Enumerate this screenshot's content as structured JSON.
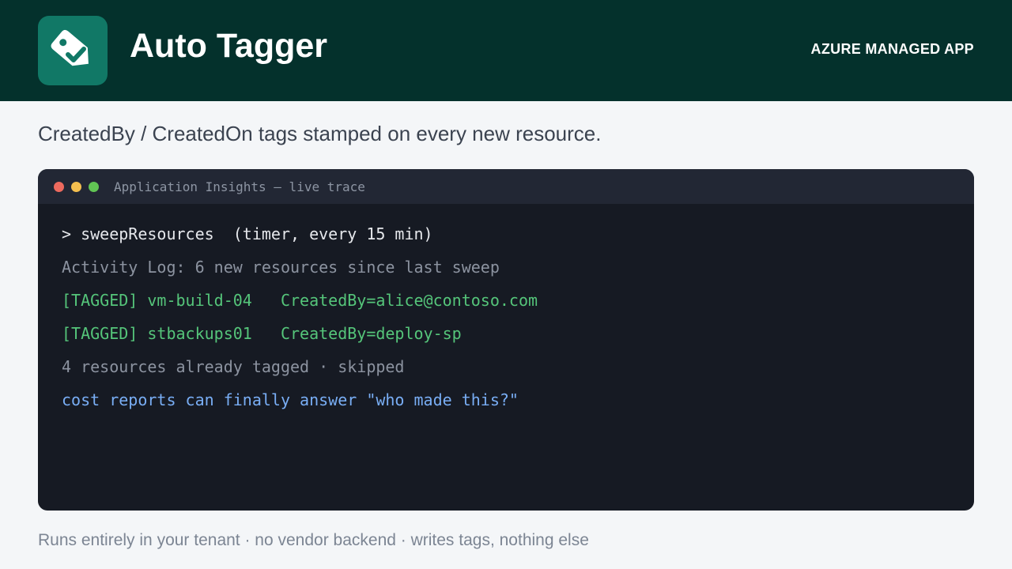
{
  "header": {
    "title": "Auto Tagger",
    "badge": "AZURE MANAGED APP",
    "icon": "tag-check-icon"
  },
  "subtitle": "CreatedBy / CreatedOn tags stamped on every new resource.",
  "terminal": {
    "title": "Application Insights — live trace",
    "lines": [
      {
        "text": "> sweepResources  (timer, every 15 min)",
        "kind": "command"
      },
      {
        "text": "Activity Log: 6 new resources since last sweep",
        "kind": "info"
      },
      {
        "text": "[TAGGED] vm-build-04   CreatedBy=alice@contoso.com",
        "kind": "success"
      },
      {
        "text": "[TAGGED] stbackups01   CreatedBy=deploy-sp",
        "kind": "success"
      },
      {
        "text": "4 resources already tagged · skipped",
        "kind": "info"
      },
      {
        "text": "cost reports can finally answer \"who made this?\"",
        "kind": "note"
      }
    ]
  },
  "footer": "Runs entirely in your tenant · no vendor backend · writes tags, nothing else",
  "colors": {
    "header_bg": "#04312c",
    "icon_bg": "#117866",
    "success": "#55c57a",
    "note": "#79aef5"
  }
}
